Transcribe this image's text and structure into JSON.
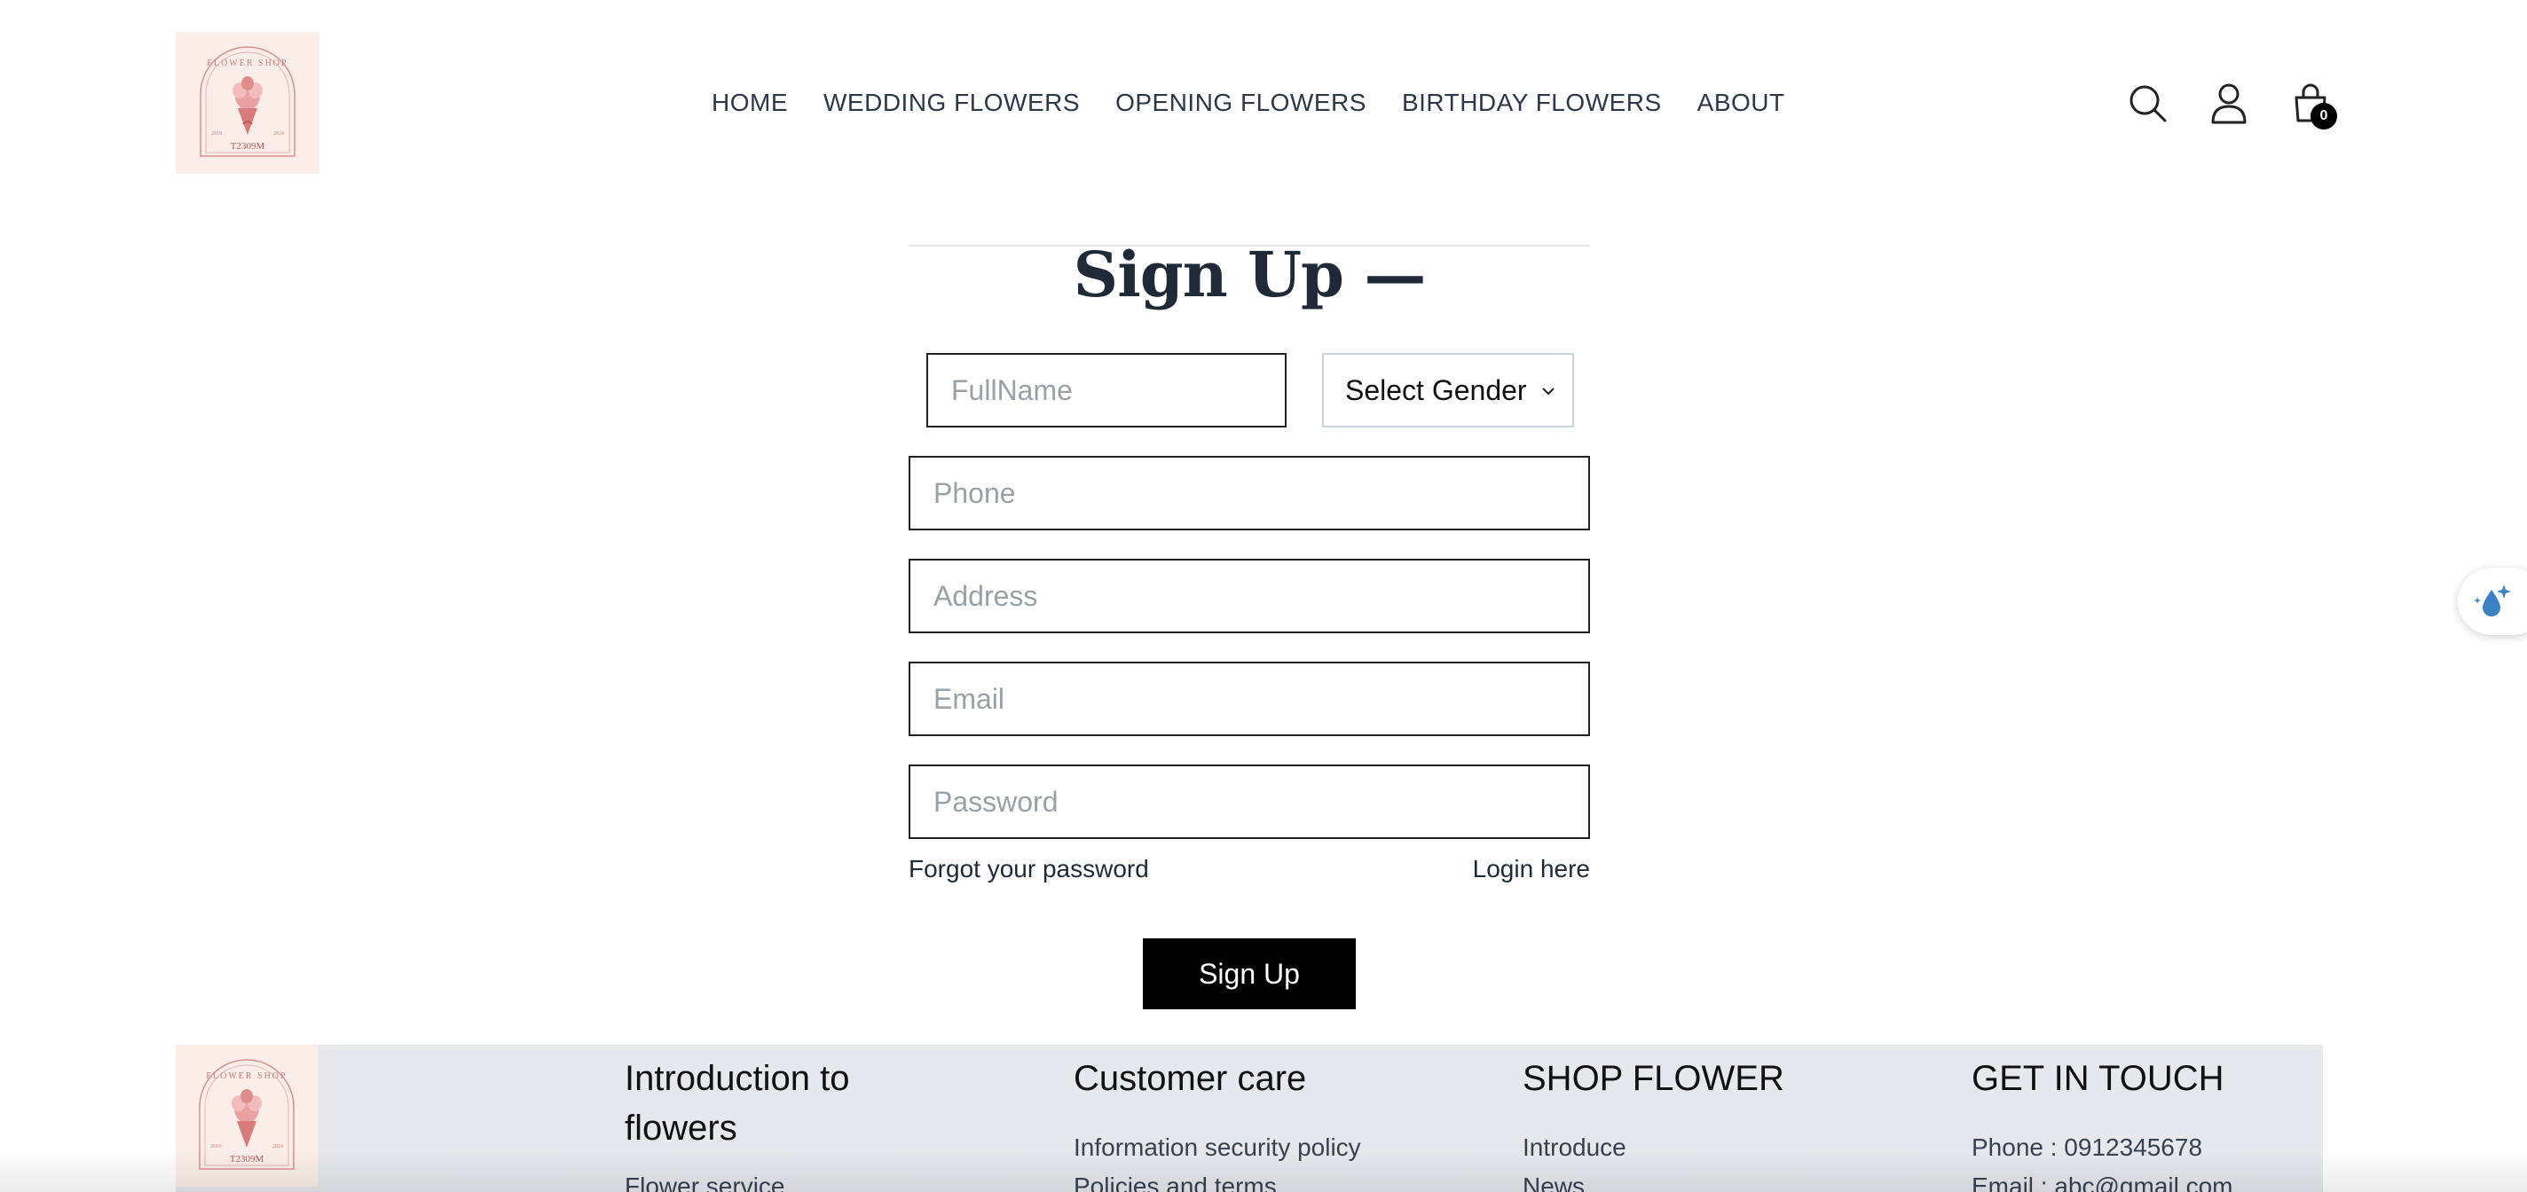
{
  "brand": {
    "logo_top_text": "FLOWER SHOP",
    "logo_bottom_text": "T2309M",
    "logo_year_left": "2019",
    "logo_year_right": "2024"
  },
  "nav": {
    "items": [
      {
        "label": "HOME"
      },
      {
        "label": "WEDDING FLOWERS"
      },
      {
        "label": "OPENING FLOWERS"
      },
      {
        "label": "BIRTHDAY FLOWERS"
      },
      {
        "label": "ABOUT"
      }
    ]
  },
  "header": {
    "cart_count": "0"
  },
  "form": {
    "title": "Sign Up —",
    "fullname_placeholder": "FullName",
    "gender_selected": "Select Gender",
    "phone_placeholder": "Phone",
    "address_placeholder": "Address",
    "email_placeholder": "Email",
    "password_placeholder": "Password",
    "forgot_link": "Forgot your password",
    "login_link": "Login here",
    "submit_label": "Sign Up"
  },
  "footer": {
    "col1": {
      "title": "Introduction to flowers",
      "items": [
        "Flower service"
      ]
    },
    "col2": {
      "title": "Customer care",
      "items": [
        "Information security policy",
        "Policies and terms"
      ]
    },
    "col3": {
      "title": "SHOP FLOWER",
      "items": [
        "Introduce",
        "News"
      ]
    },
    "col4": {
      "title": "GET IN TOUCH",
      "items": [
        "Phone : 0912345678",
        "Email : abc@gmail.com"
      ]
    }
  },
  "colors": {
    "accent": "#000000",
    "logo_bg": "#fbeee8",
    "footer_bg": "#e6e8eb"
  }
}
